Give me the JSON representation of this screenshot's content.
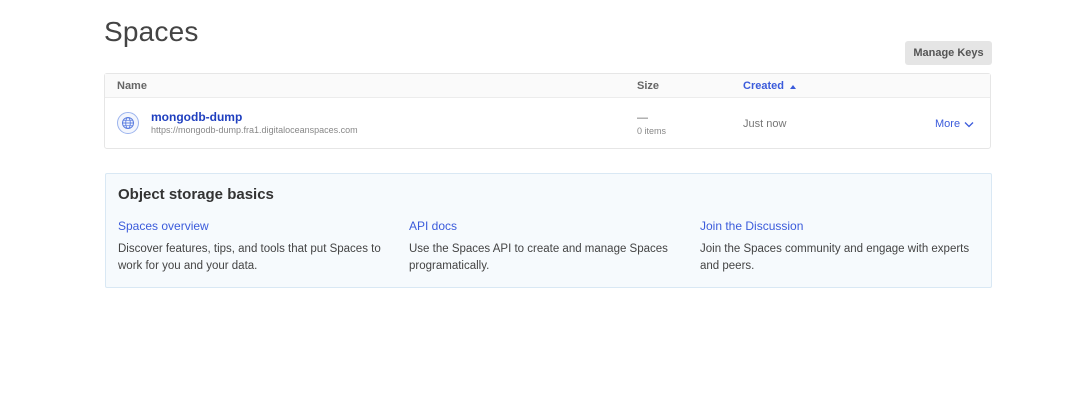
{
  "page": {
    "title": "Spaces"
  },
  "toolbar": {
    "manage_keys_label": "Manage Keys"
  },
  "table": {
    "columns": {
      "name": "Name",
      "size": "Size",
      "created": "Created"
    },
    "sort": {
      "column": "created",
      "direction": "ascending"
    },
    "rows": [
      {
        "icon": "space-globe-icon",
        "name": "mongodb-dump",
        "url": "https://mongodb-dump.fra1.digitaloceanspaces.com",
        "size": "—",
        "items": "0 items",
        "created": "Just now",
        "more_label": "More"
      }
    ]
  },
  "basics": {
    "title": "Object storage basics",
    "columns": [
      {
        "link": "Spaces overview",
        "description": "Discover features, tips, and tools that put Spaces to work for you and your data."
      },
      {
        "link": "API docs",
        "description": "Use the Spaces API to create and manage Spaces programatically."
      },
      {
        "link": "Join the Discussion",
        "description": "Join the Spaces community and engage with experts and peers."
      }
    ]
  },
  "colors": {
    "accent": "#3b5bdb",
    "space_name": "#1f3fbf",
    "basics_background": "#f6fafd",
    "button_background": "#e5e5e5"
  }
}
